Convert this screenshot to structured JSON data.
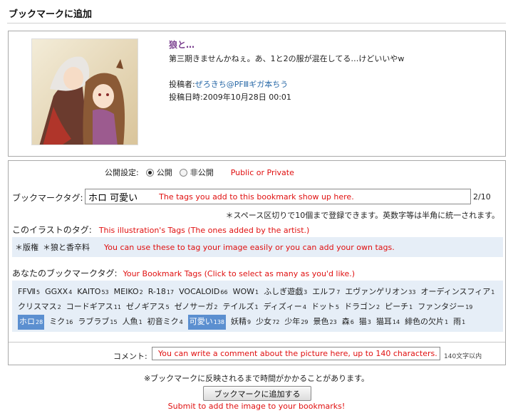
{
  "header": {
    "title": "ブックマークに追加"
  },
  "work": {
    "title": "狼と…",
    "caption": "第三期きませんかねぇ。あ、1と2の服が混在してる…けどいいやw",
    "poster_label": "投稿者:",
    "poster_name": "ぜろきち@PFⅢギガ本ちう",
    "date_label": "投稿日時:",
    "date_value": "2009年10月28日 00:01"
  },
  "privacy": {
    "label": "公開設定:",
    "options": [
      "公開",
      "非公開"
    ],
    "selected": "公開",
    "note": "Public or Private"
  },
  "bookmark_tags": {
    "label": "ブックマークタグ:",
    "value": "ホロ 可愛い",
    "note": "The tags you add to this bookmark show up here.",
    "count": "2/10",
    "hint": "＊スペース区切りで10個まで登録できます。英数字等は半角に統一されます。"
  },
  "illust_tags": {
    "label": "このイラストのタグ:",
    "note": "This illustration's Tags (The ones added by the artist.)",
    "tags": [
      "＊版権",
      "＊狼と香辛料"
    ],
    "hint": "You can use these to tag your image easily or you can add your own tags."
  },
  "my_tags": {
    "label": "あなたのブックマークタグ:",
    "note": "Your Bookmark Tags (Click to select as many as you'd like.)",
    "tags": [
      {
        "name": "FFⅦ",
        "count": "5"
      },
      {
        "name": "GGXX",
        "count": "4"
      },
      {
        "name": "KAITO",
        "count": "53"
      },
      {
        "name": "MEIKO",
        "count": "2"
      },
      {
        "name": "R-18",
        "count": "17"
      },
      {
        "name": "VOCALOID",
        "count": "66"
      },
      {
        "name": "WOW",
        "count": "1"
      },
      {
        "name": "ふしぎ遊戯",
        "count": "3"
      },
      {
        "name": "エルフ",
        "count": "7"
      },
      {
        "name": "エヴァンゲリオン",
        "count": "33"
      },
      {
        "name": "オーディンスフィア",
        "count": "1"
      },
      {
        "name": "クリスマス",
        "count": "2"
      },
      {
        "name": "コードギアス",
        "count": "11"
      },
      {
        "name": "ゼノギアス",
        "count": "5"
      },
      {
        "name": "ゼノサーガ",
        "count": "2"
      },
      {
        "name": "テイルズ",
        "count": "1"
      },
      {
        "name": "ディズィー",
        "count": "4"
      },
      {
        "name": "ドット",
        "count": "5"
      },
      {
        "name": "ドラゴン",
        "count": "2"
      },
      {
        "name": "ピーチ",
        "count": "1"
      },
      {
        "name": "ファンタジー",
        "count": "19"
      },
      {
        "name": "ホロ",
        "count": "28",
        "selected": true
      },
      {
        "name": "ミク",
        "count": "16"
      },
      {
        "name": "ラブラブ",
        "count": "15"
      },
      {
        "name": "人魚",
        "count": "1"
      },
      {
        "name": "初音ミク",
        "count": "4"
      },
      {
        "name": "可愛い",
        "count": "138",
        "selected": true
      },
      {
        "name": "妖精",
        "count": "9"
      },
      {
        "name": "少女",
        "count": "72"
      },
      {
        "name": "少年",
        "count": "29"
      },
      {
        "name": "景色",
        "count": "23"
      },
      {
        "name": "森",
        "count": "6"
      },
      {
        "name": "猫",
        "count": "3"
      },
      {
        "name": "猫耳",
        "count": "14"
      },
      {
        "name": "緋色の欠片",
        "count": "1"
      },
      {
        "name": "雨",
        "count": "1"
      }
    ]
  },
  "comment": {
    "label": "コメント:",
    "note": "You can write a comment about the picture here, up to 140 characters.",
    "limit": "140文字以内"
  },
  "footer": {
    "notice": "※ブックマークに反映されるまで時間がかかることがあります。",
    "submit_label": "ブックマークに追加する",
    "submit_note": "Submit to add the image to your bookmarks!"
  },
  "colors": {
    "note_red": "#e01010",
    "link_blue": "#2a6aa8",
    "tag_selected": "#5b8fd0",
    "tag_bg": "#e6eef7",
    "title_purple": "#7a3f8f"
  }
}
